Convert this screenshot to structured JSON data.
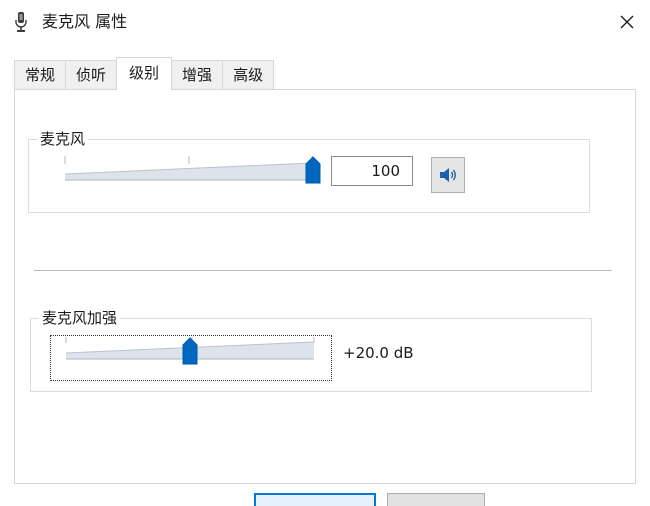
{
  "window": {
    "title": "麦克风 属性",
    "icon": "microphone-icon",
    "close_icon": "close-icon"
  },
  "tabs": [
    {
      "label": "常规",
      "active": false
    },
    {
      "label": "侦听",
      "active": false
    },
    {
      "label": "级别",
      "active": true
    },
    {
      "label": "增强",
      "active": false
    },
    {
      "label": "高级",
      "active": false
    }
  ],
  "microphone": {
    "label": "麦克风",
    "value": "100",
    "level_percent": 100,
    "speaker_icon": "speaker-volume-icon"
  },
  "boost": {
    "label": "麦克风加强",
    "value": "+20.0 dB",
    "level_fraction": 0.5
  },
  "colors": {
    "accent": "#0067c0",
    "track": "#d9dfe6",
    "border": "#d6d6d6"
  }
}
